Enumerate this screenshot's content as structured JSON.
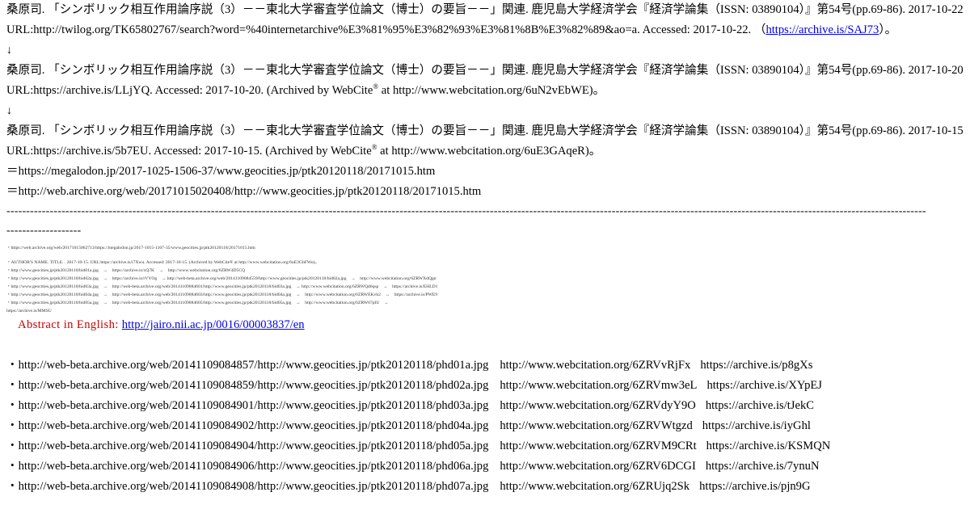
{
  "citations": [
    {
      "line1": "桑原司. 「シンボリック相互作用論序説（3）－－東北大学審査学位論文（博士）の要旨－－」関連. 鹿児島大学経済学会『経済学論集（ISSN: 03890104）』第54号(pp.69-86). 2017-10-22.",
      "line2_pre": "URL:http://twilog.org/TK65802767/search?word=%40internetarchive%E3%81%95%E3%82%93%E3%81%8B%E3%82%89&ao=a. Accessed: 2017-10-22. （",
      "line2_link": "https://archive.is/SAJ73",
      "line2_post": "）。"
    },
    {
      "line1": "桑原司. 「シンボリック相互作用論序説（3）－－東北大学審査学位論文（博士）の要旨－－」関連. 鹿児島大学経済学会『経済学論集（ISSN: 03890104）』第54号(pp.69-86). 2017-10-20.",
      "line2_pre": "URL:https://archive.is/LLjYQ. Accessed: 2017-10-20. (Archived by WebCite",
      "line2_sup": "®",
      "line2_post": " at http://www.webcitation.org/6uN2vEbWE)。"
    },
    {
      "line1": "桑原司. 「シンボリック相互作用論序説（3）－－東北大学審査学位論文（博士）の要旨－－」関連. 鹿児島大学経済学会『経済学論集（ISSN: 03890104）』第54号(pp.69-86). 2017-10-15.",
      "line2_pre": "URL:https://archive.is/5b7EU. Accessed: 2017-10-15. (Archived by WebCite",
      "line2_sup": "®",
      "line2_post": " at http://www.webcitation.org/6uE3GAqeR)。"
    }
  ],
  "arrow": "↓",
  "equals_lines": [
    "＝https://megalodon.jp/2017-1025-1506-37/www.geocities.jp/ptk20120118/20171015.htm",
    "＝http://web.archive.org/web/20171015020408/http://www.geocities.jp/ptk20120118/20171015.htm"
  ],
  "dashes_long": "------------------------------------------------------------------------------------------------------------------------------------------------------------------------------------------------------------------------------------------",
  "dashes_short": "-------------------",
  "tiny_lines": [
    "・https://web.archive.org/web/20171015062713/https://megalodon.jp/2017-1015-1107-35/www.geocities.jp/ptk20120118/20171015.htm",
    "",
    "・AUTHOR'S NAME. TITLE. . 2017-10-15. URL:https://archive.is/i7Xwu. Accessed: 2017-10-15. (Archived by WebCite® at http://www.webcitation.org/6uE3GbFWo)。",
    "・http://www.geocities.jp/ptk20120118/bid01a.jpg　→　https://archive.is/xQ7K　→　http://www.webcitation.org/6ZRW4D5CQ",
    "・http://www.geocities.jp/ptk20120118/bid02a.jpg　→　https://archive.is/rVYOg　→ http://web-beta.archive.org/web/20141109084559/http://www.geocities.jp/ptk20120118/bid02a.jpg　→　http://www.webcitation.org/6ZRWXdQgn",
    "・http://www.geocities.jp/ptk20120118/bid03a.jpg　→　http://web-beta.archive.org/web/20141109084601/http://www.geocities.jp/ptk20120118/bid03a.jpg　→ http://www.webcitation.org/6ZRWQd6qsp　→　https://archive.is/EHLD1",
    "・http://www.geocities.jp/ptk20120118/bid04a.jpg　→　http://web-beta.archive.org/web/20141109084603/http://www.geocities.jp/ptk20120118/bid04a.jpg　→　http://www.webcitation.org/6ZRWEKvb2　→　https://archive.is/PWE9",
    "・http://www.geocities.jp/ptk20120118/bid05a.jpg　→　http://web-beta.archive.org/web/20141109084605/http://www.geocities.jp/ptk20120118/bid05a.jpg　→　http://www.webcitation.org/6ZRW67pIU　→",
    "https://archive.is/MMSU"
  ],
  "abstract": {
    "label": "Abstract in English: ",
    "link": "http://jairo.nii.ac.jp/0016/00003837/en"
  },
  "image_rows": [
    {
      "a": "・http://web-beta.archive.org/web/20141109084857/http://www.geocities.jp/ptk20120118/phd01a.jpg",
      "b": "http://www.webcitation.org/6ZRVvRjFx",
      "c": "https://archive.is/p8gXs"
    },
    {
      "a": "・http://web-beta.archive.org/web/20141109084859/http://www.geocities.jp/ptk20120118/phd02a.jpg",
      "b": "http://www.webcitation.org/6ZRVmw3eL",
      "c": "https://archive.is/XYpEJ"
    },
    {
      "a": "・http://web-beta.archive.org/web/20141109084901/http://www.geocities.jp/ptk20120118/phd03a.jpg",
      "b": "http://www.webcitation.org/6ZRVdyY9O",
      "c": "https://archive.is/tJekC"
    },
    {
      "a": "・http://web-beta.archive.org/web/20141109084902/http://www.geocities.jp/ptk20120118/phd04a.jpg",
      "b": "http://www.webcitation.org/6ZRVWtgzd",
      "c": "https://archive.is/iyGhl"
    },
    {
      "a": "・http://web-beta.archive.org/web/20141109084904/http://www.geocities.jp/ptk20120118/phd05a.jpg",
      "b": "http://www.webcitation.org/6ZRVM9CRt",
      "c": "https://archive.is/KSMQN"
    },
    {
      "a": "・http://web-beta.archive.org/web/20141109084906/http://www.geocities.jp/ptk20120118/phd06a.jpg",
      "b": "http://www.webcitation.org/6ZRV6DCGI",
      "c": "https://archive.is/7ynuN"
    },
    {
      "a": "・http://web-beta.archive.org/web/20141109084908/http://www.geocities.jp/ptk20120118/phd07a.jpg",
      "b": "http://www.webcitation.org/6ZRUjq2Sk",
      "c": "https://archive.is/pjn9G"
    }
  ],
  "colors": {
    "link": "#0000ee",
    "abstract_label": "#cc0000",
    "text": "#000000"
  }
}
